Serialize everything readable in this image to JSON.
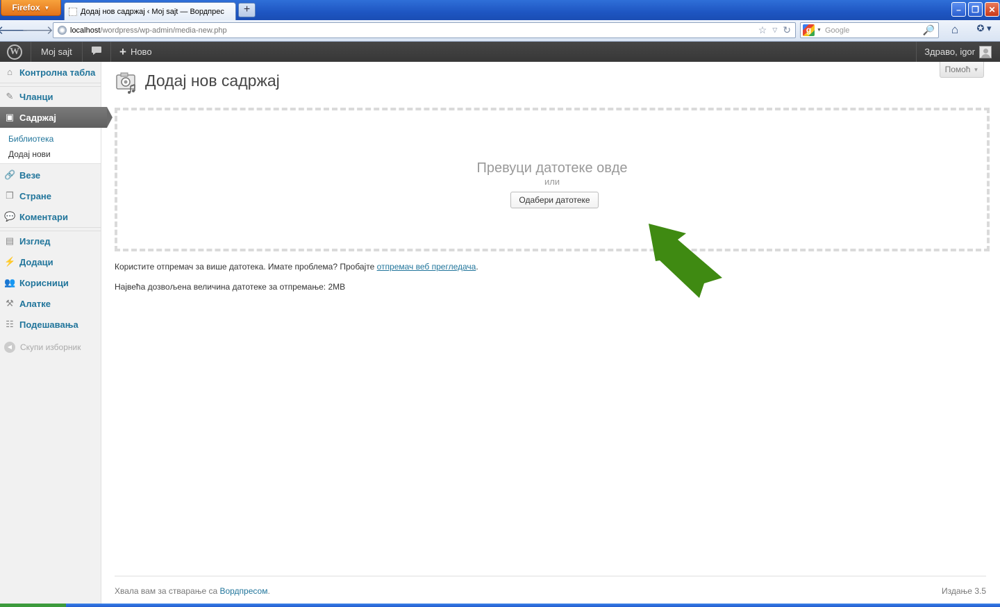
{
  "browser": {
    "app_button": "Firefox",
    "tab_title": "Додај нов садржај ‹ Moj sajt — Вордпрес",
    "url_host": "localhost",
    "url_path": "/wordpress/wp-admin/media-new.php",
    "search_placeholder": "Google"
  },
  "adminbar": {
    "site_name": "Moj sajt",
    "new_label": "Ново",
    "howdy": "Здраво, igor"
  },
  "sidebar": {
    "dashboard": "Контролна табла",
    "posts": "Чланци",
    "media": "Садржај",
    "media_sub": {
      "library": "Библиотека",
      "add_new": "Додај нови"
    },
    "links": "Везе",
    "pages": "Стране",
    "comments": "Коментари",
    "appearance": "Изглед",
    "plugins": "Додаци",
    "users": "Корисници",
    "tools": "Алатке",
    "settings": "Подешавања",
    "collapse": "Скупи изборник"
  },
  "main": {
    "help_label": "Помоћ",
    "title": "Додај нов садржај",
    "drop_text": "Превуци датотеке овде",
    "or_text": "или",
    "select_button": "Одабери датотеке",
    "note_prefix": "Користите отпремач за више датотека. Имате проблема? Пробајте ",
    "note_link": "отпремач веб прегледача",
    "note_suffix": ".",
    "max_size": "Највећа дозвољена величина датотеке за отпремање: 2MB"
  },
  "footer": {
    "thanks_prefix": "Хвала вам за стварање са ",
    "thanks_link": "Вордпресом",
    "thanks_suffix": ".",
    "version": "Издање 3.5"
  },
  "colors": {
    "wp_link": "#21759b",
    "admin_bar": "#464646",
    "arrow": "#3f8a12"
  }
}
